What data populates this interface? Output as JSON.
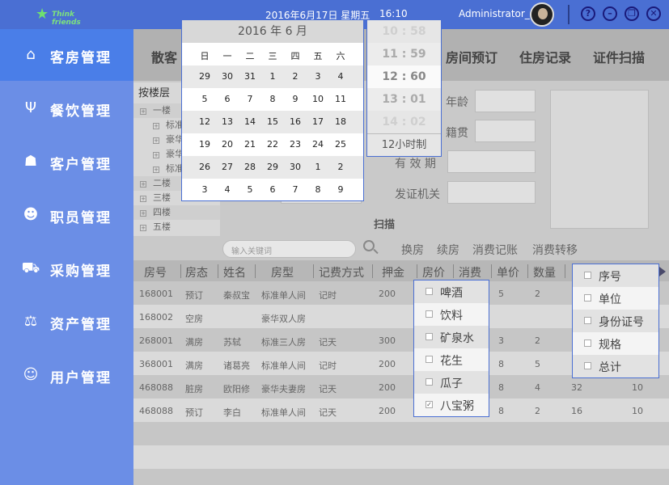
{
  "header": {
    "logo_text": "Think friends",
    "date": "2016年6月17日  星期五",
    "time": "16:10",
    "user": "Administrator_1",
    "window_buttons": [
      "?",
      "–",
      "❐",
      "✕"
    ]
  },
  "sidebar": {
    "items": [
      {
        "label": "客房管理",
        "icon": "bed-icon",
        "glyph": "⌂"
      },
      {
        "label": "餐饮管理",
        "icon": "utensils-icon",
        "glyph": "Ψ"
      },
      {
        "label": "客户管理",
        "icon": "customers-icon",
        "glyph": "☗"
      },
      {
        "label": "职员管理",
        "icon": "staff-icon",
        "glyph": "☻"
      },
      {
        "label": "采购管理",
        "icon": "cart-icon",
        "glyph": "⛟"
      },
      {
        "label": "资产管理",
        "icon": "scale-icon",
        "glyph": "⚖"
      },
      {
        "label": "用户管理",
        "icon": "user-icon",
        "glyph": "☺"
      }
    ]
  },
  "tabs": [
    "散客",
    "房间预订",
    "住房记录",
    "证件扫描"
  ],
  "tree": {
    "header": "按楼层",
    "items": [
      {
        "label": "一楼",
        "level": 1
      },
      {
        "label": "标准",
        "level": 2
      },
      {
        "label": "豪华",
        "level": 2
      },
      {
        "label": "豪华",
        "level": 2
      },
      {
        "label": "标准",
        "level": 2
      },
      {
        "label": "二楼",
        "level": 1
      },
      {
        "label": "三楼",
        "level": 1
      },
      {
        "label": "四楼",
        "level": 1
      },
      {
        "label": "五楼",
        "level": 1
      }
    ]
  },
  "form": {
    "age_label": "年龄",
    "origin_label": "籍贯",
    "valid_label": "有 效 期",
    "issuer_label": "发证机关",
    "scan_label": "扫描"
  },
  "search": {
    "placeholder": "输入关键词"
  },
  "actions": [
    "换房",
    "续房",
    "消费记账",
    "消费转移"
  ],
  "table": {
    "columns": [
      "房号",
      "房态",
      "姓名",
      "房型",
      "记费方式",
      "押金",
      "房价",
      "消费",
      "单价",
      "数量"
    ],
    "rows": [
      {
        "room": "168001",
        "status": "预订",
        "name": "秦叔宝",
        "type": "标准单人间",
        "billing": "记时",
        "deposit": "200",
        "price": "",
        "c1": "5",
        "c2": "2",
        "c3": "",
        "c4": ""
      },
      {
        "room": "168002",
        "status": "空房",
        "name": "",
        "type": "豪华双人房",
        "billing": "",
        "deposit": "",
        "price": "",
        "c1": "",
        "c2": "",
        "c3": "",
        "c4": ""
      },
      {
        "room": "268001",
        "status": "满房",
        "name": "苏轼",
        "type": "标准三人房",
        "billing": "记天",
        "deposit": "300",
        "price": "",
        "c1": "3",
        "c2": "2",
        "c3": "",
        "c4": ""
      },
      {
        "room": "368001",
        "status": "满房",
        "name": "诸葛亮",
        "type": "标准单人间",
        "billing": "记时",
        "deposit": "200",
        "price": "",
        "c1": "8",
        "c2": "5",
        "c3": "",
        "c4": ""
      },
      {
        "room": "468088",
        "status": "脏房",
        "name": "欧阳修",
        "type": "豪华夫妻房",
        "billing": "记天",
        "deposit": "200",
        "price": "",
        "c1": "8",
        "c2": "4",
        "c3": "32",
        "c4": "10"
      },
      {
        "room": "468088",
        "status": "预订",
        "name": "李白",
        "type": "标准单人间",
        "billing": "记天",
        "deposit": "200",
        "price": "",
        "c1": "8",
        "c2": "2",
        "c3": "16",
        "c4": "10"
      }
    ]
  },
  "calendar": {
    "year": "2016",
    "month": "6",
    "header": "2016 年 6 月",
    "weekdays": [
      "日",
      "一",
      "二",
      "三",
      "四",
      "五",
      "六"
    ],
    "weeks": [
      [
        "29",
        "30",
        "31",
        "1",
        "2",
        "3",
        "4"
      ],
      [
        "5",
        "6",
        "7",
        "8",
        "9",
        "10",
        "11"
      ],
      [
        "12",
        "13",
        "14",
        "15",
        "16",
        "17",
        "18"
      ],
      [
        "19",
        "20",
        "21",
        "22",
        "23",
        "24",
        "25"
      ],
      [
        "26",
        "27",
        "28",
        "29",
        "30",
        "1",
        "2"
      ],
      [
        "3",
        "4",
        "5",
        "6",
        "7",
        "8",
        "9"
      ]
    ]
  },
  "time_picker": {
    "rows": [
      "10 : 58",
      "11 : 59",
      "12 : 60",
      "13 : 01",
      "14 : 02"
    ],
    "mode": "12小时制"
  },
  "consumption_dropdown": {
    "items": [
      {
        "label": "啤酒",
        "checked": false
      },
      {
        "label": "饮料",
        "checked": false
      },
      {
        "label": "矿泉水",
        "checked": false
      },
      {
        "label": "花生",
        "checked": false
      },
      {
        "label": "瓜子",
        "checked": false
      },
      {
        "label": "八宝粥",
        "checked": true
      }
    ]
  },
  "column_dropdown": {
    "items": [
      {
        "label": "序号",
        "checked": false
      },
      {
        "label": "单位",
        "checked": false
      },
      {
        "label": "身份证号",
        "checked": false
      },
      {
        "label": "规格",
        "checked": false
      },
      {
        "label": "总计",
        "checked": false
      }
    ]
  }
}
